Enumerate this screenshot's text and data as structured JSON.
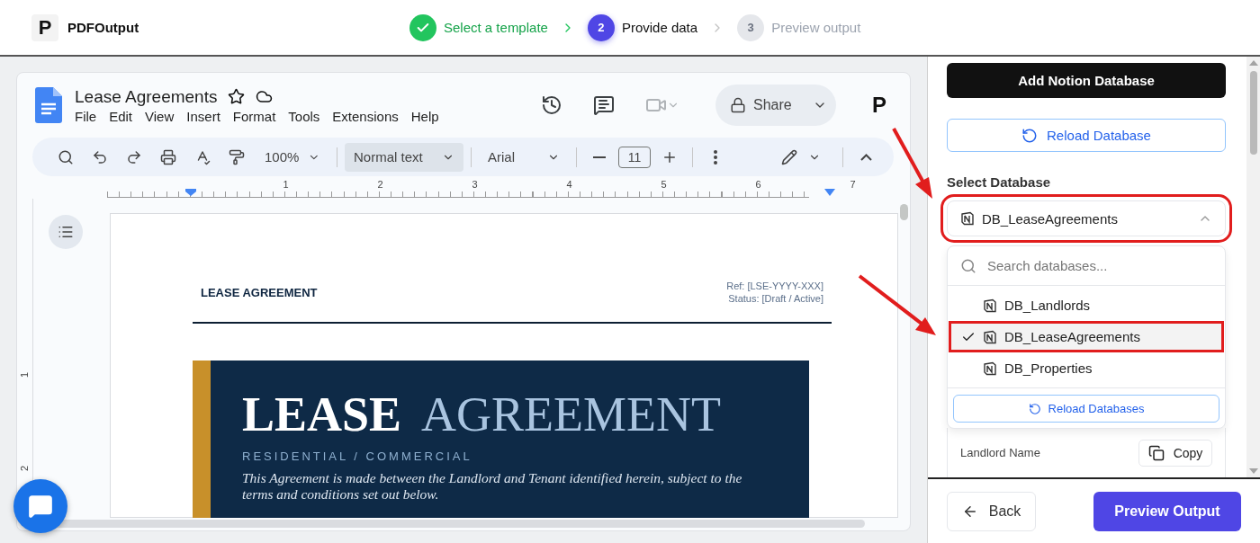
{
  "app": {
    "logo_letter": "P",
    "name": "PDFOutput"
  },
  "steps": [
    {
      "label": "Select a template",
      "completed": true,
      "selected": false
    },
    {
      "number": "2",
      "label": "Provide data",
      "completed": false,
      "selected": true
    },
    {
      "number": "3",
      "label": "Preview output",
      "completed": false,
      "selected": false
    }
  ],
  "doc_editor": {
    "title": "Lease Agreements",
    "menu": [
      "File",
      "Edit",
      "View",
      "Insert",
      "Format",
      "Tools",
      "Extensions",
      "Help"
    ],
    "share_label": "Share",
    "account_letter": "P",
    "toolbar": {
      "zoom": "100%",
      "paragraph_style": "Normal text",
      "font": "Arial",
      "font_size": "11"
    },
    "ruler_numbers": [
      "1",
      "2",
      "3",
      "4",
      "5",
      "6",
      "7"
    ],
    "vertical_ruler_numbers": [
      "1",
      "2"
    ]
  },
  "document": {
    "header_title": "LEASE AGREEMENT",
    "ref": "Ref: [LSE-YYYY-XXX]",
    "status": "Status: [Draft / Active]",
    "banner": {
      "title_bold": "LEASE",
      "title_light": "AGREEMENT",
      "subtitle": "RESIDENTIAL / COMMERCIAL",
      "description": "This Agreement is made between the Landlord and Tenant identified herein, subject to the terms and conditions set out below."
    }
  },
  "sidebar": {
    "add_button": "Add Notion Database",
    "reload_button": "Reload Database",
    "select_label": "Select Database",
    "select": {
      "value": "DB_LeaseAgreements",
      "expanded": true,
      "highlighted": true
    },
    "search_placeholder": "Search databases...",
    "options": [
      {
        "label": "DB_Landlords",
        "selected": false,
        "highlighted": false
      },
      {
        "label": "DB_LeaseAgreements",
        "selected": true,
        "highlighted": true
      },
      {
        "label": "DB_Properties",
        "selected": false,
        "highlighted": false
      }
    ],
    "dropdown_reload": "Reload Databases",
    "field": {
      "label": "Landlord Name",
      "copy_button": "Copy"
    }
  },
  "footer": {
    "back": "Back",
    "preview": "Preview Output"
  }
}
